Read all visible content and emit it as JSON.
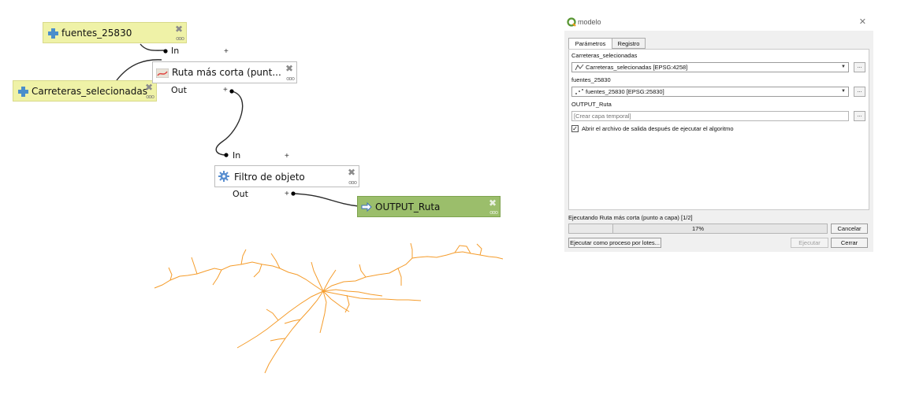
{
  "model": {
    "inputs": [
      {
        "name": "fuentes_25830"
      },
      {
        "name": "Carreteras_selecionadas"
      }
    ],
    "algorithms": [
      {
        "name": "Ruta más corta (punt..."
      },
      {
        "name": "Filtro de objeto"
      }
    ],
    "output": {
      "name": "OUTPUT_Ruta"
    },
    "ports": {
      "in": "In",
      "out": "Out",
      "plus": "+"
    }
  },
  "dialog": {
    "title": "modelo",
    "tabs": [
      "Parámetros",
      "Registro"
    ],
    "active_tab": "Parámetros",
    "params": [
      {
        "label": "Carreteras_selecionadas",
        "value": "Carreteras_selecionadas [EPSG:4258]",
        "icon": "line-layer-icon"
      },
      {
        "label": "fuentes_25830",
        "value": "fuentes_25830 [EPSG:25830]",
        "icon": "point-layer-icon"
      }
    ],
    "output_label": "OUTPUT_Ruta",
    "output_placeholder": "[Crear capa temporal]",
    "browse_label": "...",
    "checkbox_label": "Abrir el archivo de salida después de ejecutar el algoritmo",
    "checkbox_checked": true,
    "status": "Ejecutando Ruta más corta (punto a capa) [1/2]",
    "progress": 17,
    "progress_text": "17%",
    "cancel_label": "Cancelar",
    "batch_label": "Ejecutar como proceso por lotes...",
    "run_label": "Ejecutar",
    "close_label": "Cerrar"
  },
  "colors": {
    "input_node": "#eff2a7",
    "output_node": "#9bbe6b",
    "network_line": "#f59c2b"
  }
}
